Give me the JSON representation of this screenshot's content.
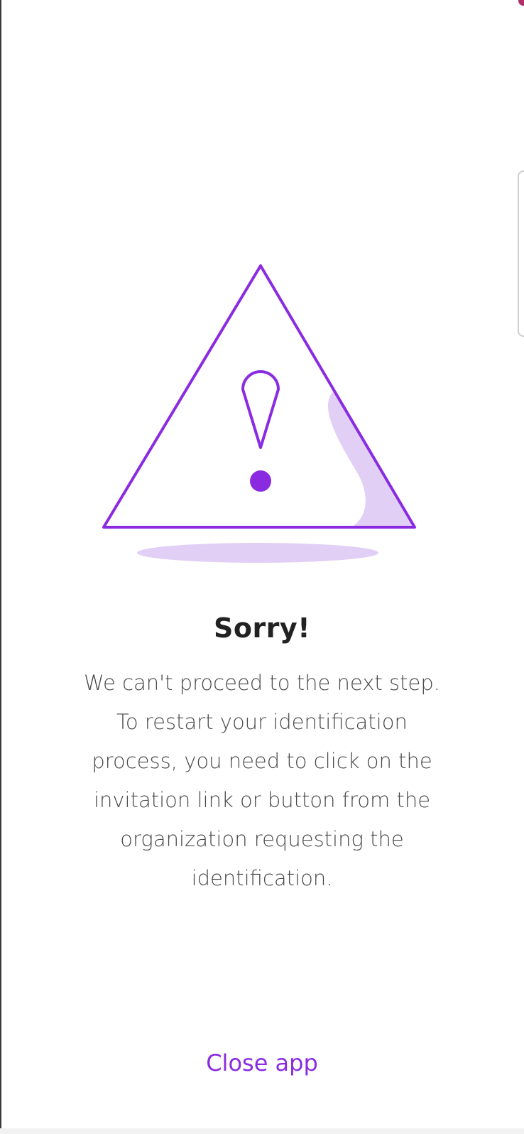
{
  "dialog": {
    "icon": "warning-icon",
    "title": "Sorry!",
    "message": "We can't proceed to the next step. To restart your identification process, you need to click on the invitation link or button from the organization requesting the identification.",
    "close_label": "Close app"
  },
  "colors": {
    "accent": "#8a2be2",
    "accent_light": "#e2cff5",
    "title": "#222222",
    "body_text": "#4a4a4a"
  }
}
